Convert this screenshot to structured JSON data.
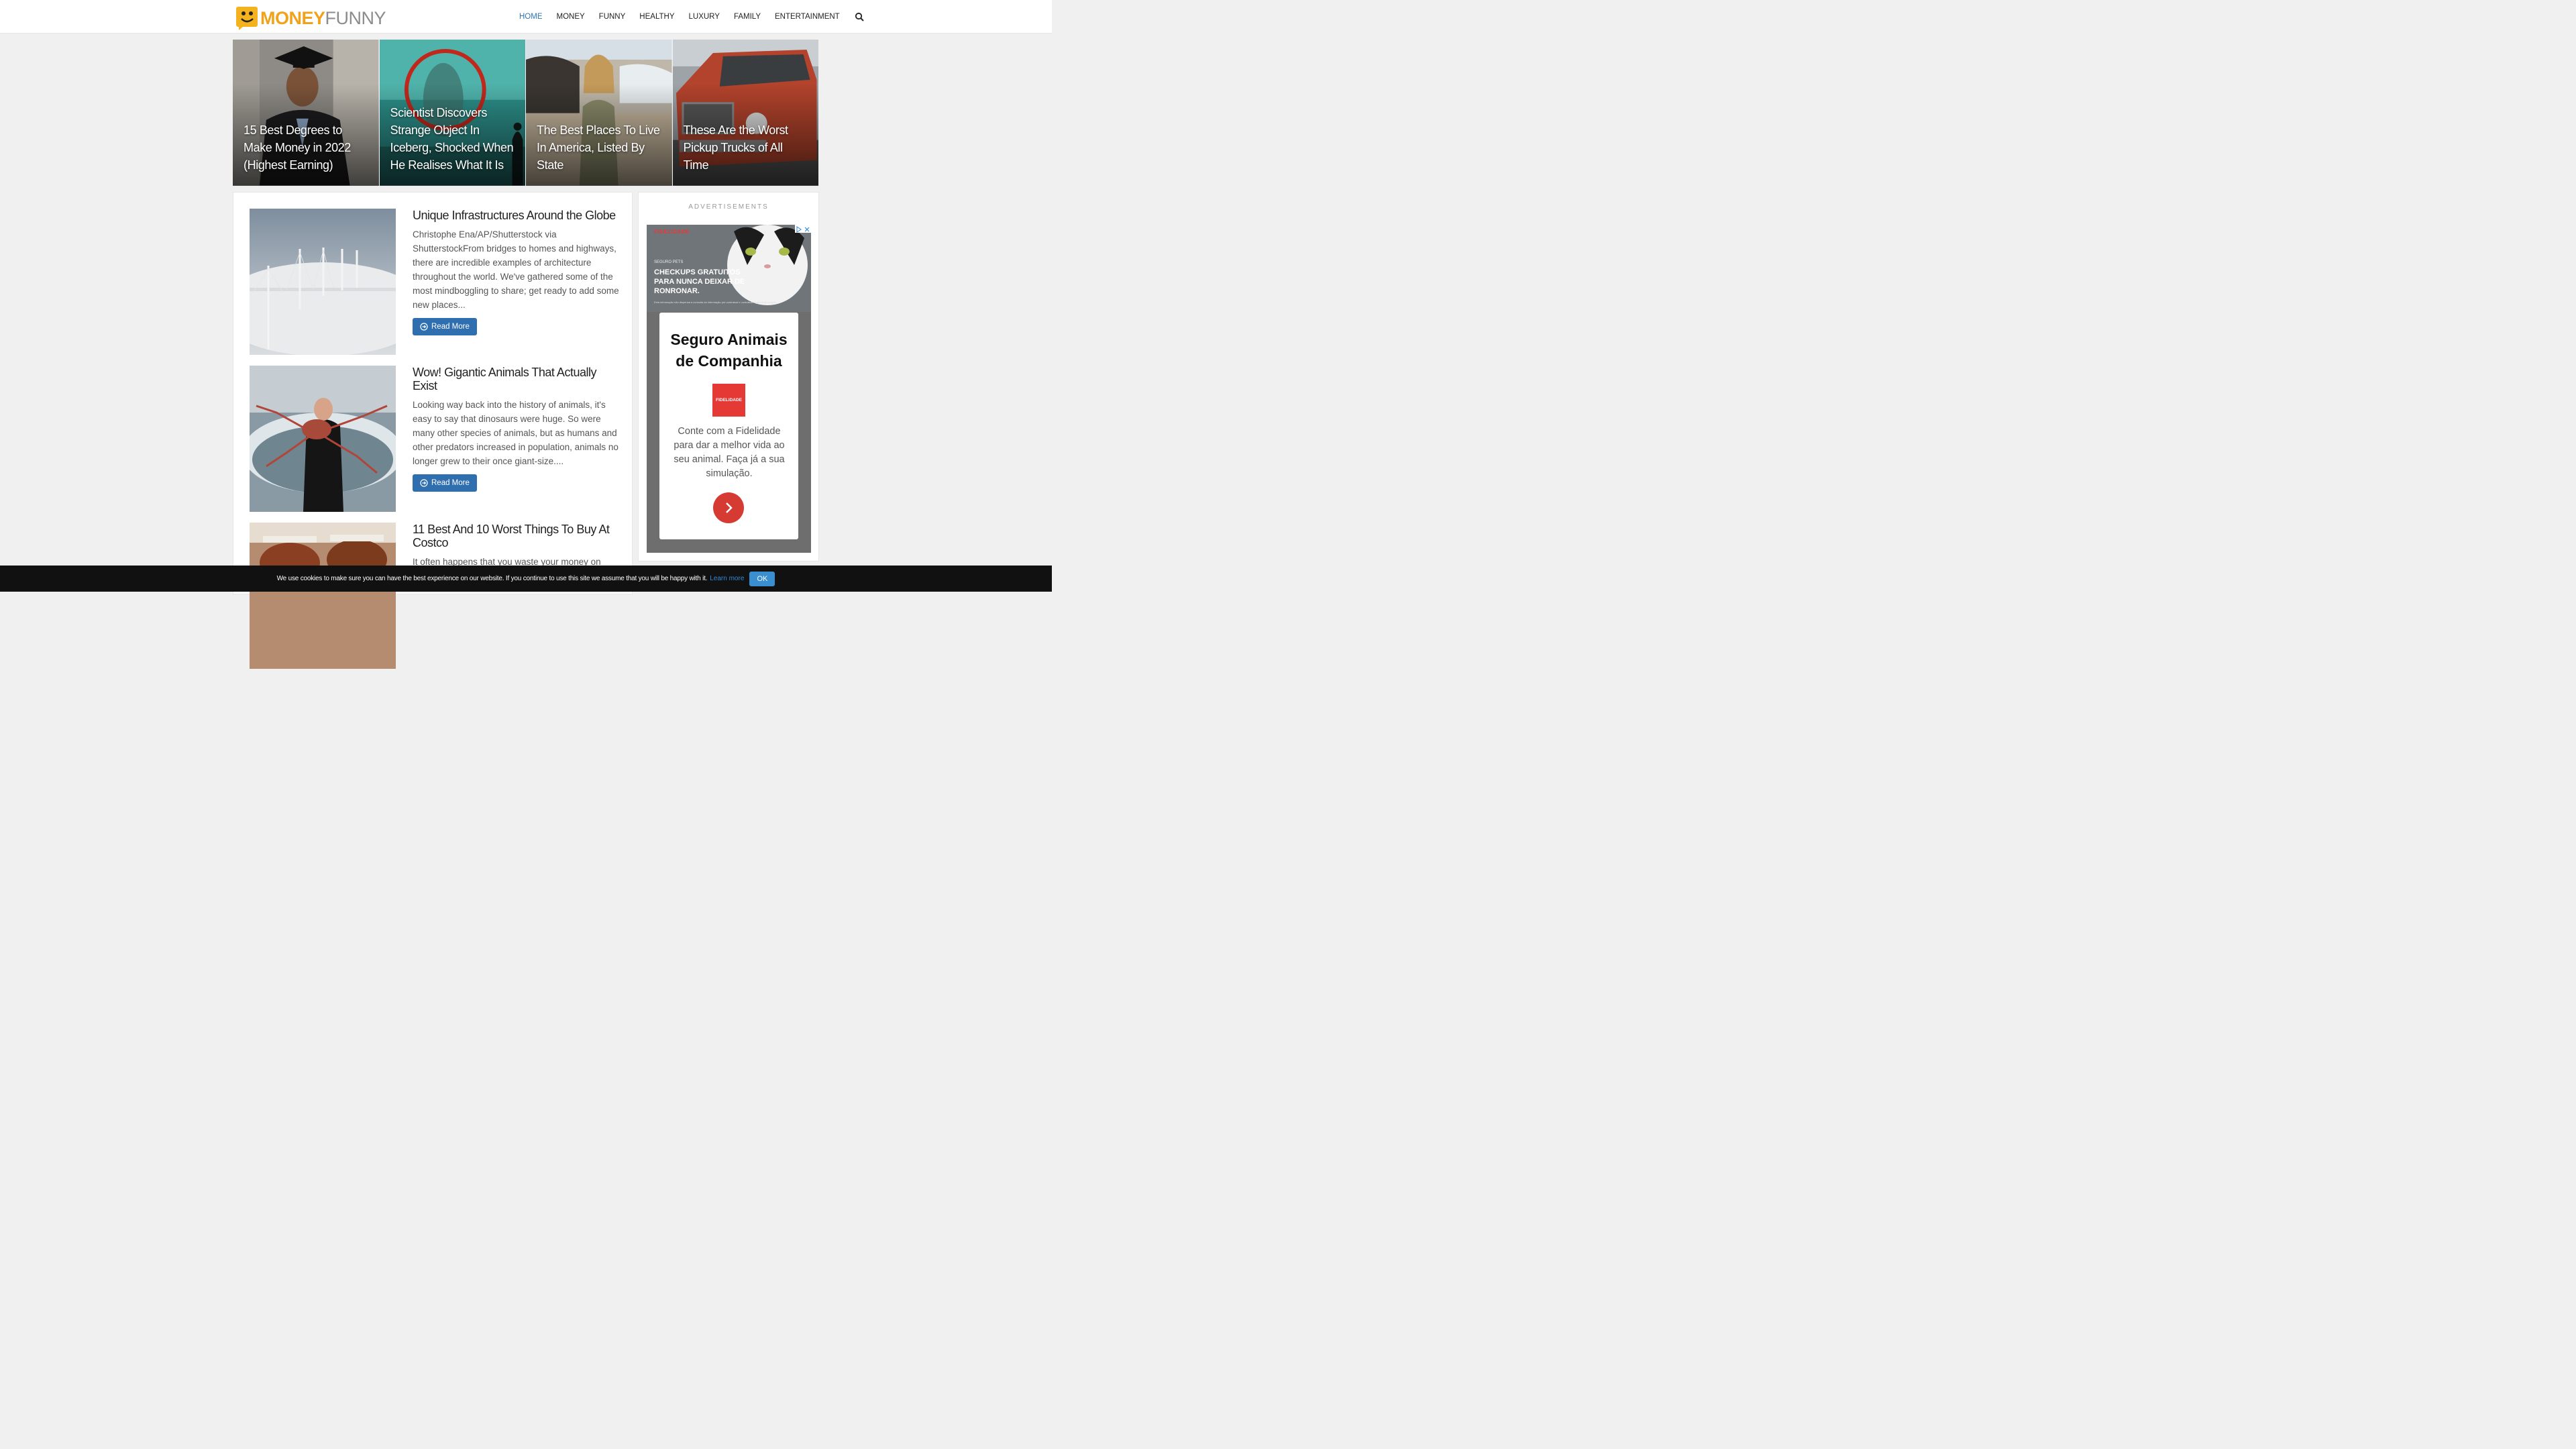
{
  "logo": {
    "money": "MONEY",
    "funny": "FUNNY"
  },
  "nav": {
    "items": [
      "HOME",
      "MONEY",
      "FUNNY",
      "HEALTHY",
      "LUXURY",
      "FAMILY",
      "ENTERTAINMENT"
    ],
    "active": "HOME"
  },
  "featured": [
    {
      "title": "15 Best Degrees to Make Money in 2022 (Highest Earning)"
    },
    {
      "title": "Scientist Discovers Strange Object In Iceberg, Shocked When He Realises What It Is"
    },
    {
      "title": "The Best Places To Live In America, Listed By State"
    },
    {
      "title": "These Are the Worst Pickup Trucks of All Time"
    }
  ],
  "articles": [
    {
      "title": "Unique Infrastructures Around the Globe",
      "excerpt": "Christophe Ena/AP/Shutterstock via ShutterstockFrom bridges to homes and highways, there are incredible examples of architecture throughout the world. We've gathered some of the most mindboggling to share; get ready to add some new places...",
      "read_more": "Read More"
    },
    {
      "title": "Wow! Gigantic Animals That Actually Exist",
      "excerpt": "Looking way back into the history of animals, it's easy to say that dinosaurs were huge. So were many other species of animals, but as humans and other predators increased in population, animals no longer grew to their once giant-size....",
      "read_more": "Read More"
    },
    {
      "title": "11 Best And 10 Worst Things To Buy At Costco",
      "excerpt": "It often happens that you waste your money on some"
    }
  ],
  "sidebar": {
    "ads_label": "ADVERTISEMENTS",
    "ad": {
      "brand": "FIDELIDADE",
      "small": "SEGURO PETS",
      "headline": "CHECKUPS GRATUITOS PARA NUNCA DEIXAR DE RONRONAR.",
      "fine": "Esta informação não dispensa a consulta da informação pré-contratual e contratual legalmente exigida.",
      "card_title": "Seguro Animais de Companhia",
      "card_logo": "FIDELIDADE",
      "card_text": "Conte com a Fidelidade para dar a melhor vida ao seu animal. Faça já a sua simulação."
    }
  },
  "cookie": {
    "text": "We use cookies to make sure you can have the best experience on our website. If you continue to use this site we assume that you will be happy with it.",
    "link": "Learn more",
    "ok": "OK"
  },
  "colors": {
    "accent": "#2f73b3",
    "logo_orange": "#f0a21a",
    "button": "#2f6fb0",
    "ad_red": "#d63b33"
  }
}
